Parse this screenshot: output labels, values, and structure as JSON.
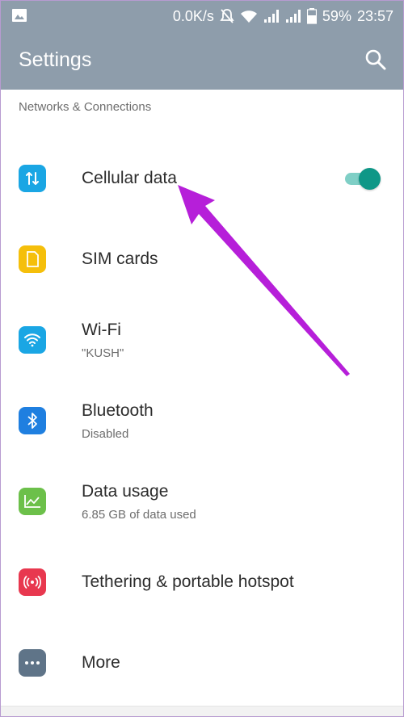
{
  "status_bar": {
    "speed": "0.0K/s",
    "battery": "59%",
    "time": "23:57",
    "icons": [
      "image-icon",
      "mute-icon",
      "wifi-icon",
      "signal-icon",
      "signal-icon",
      "battery-icon"
    ]
  },
  "appbar": {
    "title": "Settings",
    "search_icon": "search-icon",
    "background": "#8e9dab"
  },
  "section_header": "Networks & Connections",
  "items": [
    {
      "label": "Cellular data",
      "subtitle": "",
      "icon": "data-transfer-icon",
      "color": "#1aa6e4",
      "toggle": true,
      "toggle_on": true
    },
    {
      "label": "SIM cards",
      "subtitle": "",
      "icon": "sim-card-icon",
      "color": "#f5bf0b"
    },
    {
      "label": "Wi-Fi",
      "subtitle": "\"KUSH\"",
      "icon": "wifi-icon",
      "color": "#1aa6e4"
    },
    {
      "label": "Bluetooth",
      "subtitle": "Disabled",
      "icon": "bluetooth-icon",
      "color": "#1f7fe0"
    },
    {
      "label": "Data usage",
      "subtitle": "6.85 GB of data used",
      "icon": "chart-icon",
      "color": "#6cc04a"
    },
    {
      "label": "Tethering & portable hotspot",
      "subtitle": "",
      "icon": "hotspot-icon",
      "color": "#e8384f"
    },
    {
      "label": "More",
      "subtitle": "",
      "icon": "more-icon",
      "color": "#5f7488"
    }
  ],
  "annotation_color": "#b61fd9",
  "toggle_color": "#0f9787"
}
